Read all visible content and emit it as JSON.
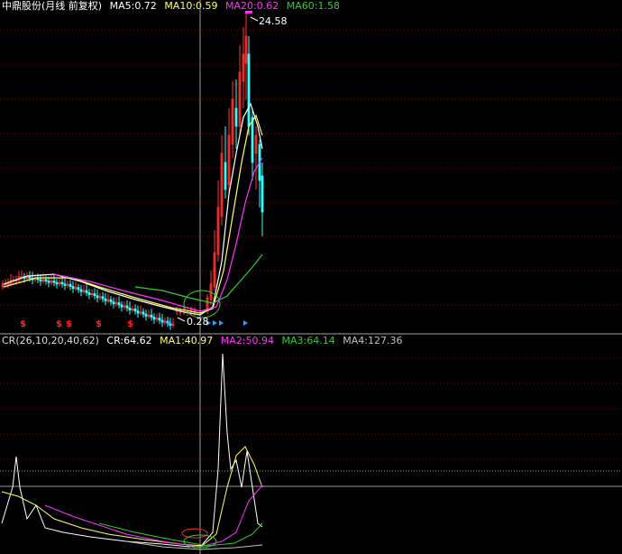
{
  "top_legend": {
    "stock_name": "中鼎股份",
    "period": "(月线 前复权)",
    "ma": [
      {
        "label": "MA5:0.72",
        "color": "#ffffff"
      },
      {
        "label": "MA10:0.59",
        "color": "#ffff66"
      },
      {
        "label": "MA20:0.62",
        "color": "#ff33ff"
      },
      {
        "label": "MA60:1.58",
        "color": "#33cc33"
      }
    ]
  },
  "price_panel": {
    "high_label": "24.58",
    "low_label": "0.28",
    "high_value": 24.58,
    "low_value": 0.28,
    "signal_markers": [
      "$",
      "$",
      "$",
      "$",
      "$",
      "$",
      "$"
    ]
  },
  "cr_legend": {
    "indicator": "CR(26,10,20,40,62)",
    "values": [
      {
        "label": "CR:64.62",
        "color": "#ffffff"
      },
      {
        "label": "MA1:40.97",
        "color": "#ffff66"
      },
      {
        "label": "MA2:50.94",
        "color": "#ff33ff"
      },
      {
        "label": "MA3:64.14",
        "color": "#33cc33"
      },
      {
        "label": "MA4:127.36",
        "color": "#c0c0c0"
      }
    ]
  },
  "colors": {
    "background": "#000000",
    "up": "#ff3333",
    "down": "#33ffff",
    "grid": "#800000",
    "frame": "#b0b0b0",
    "marker_red": "#ff2222",
    "marker_blue": "#3399ff"
  }
}
